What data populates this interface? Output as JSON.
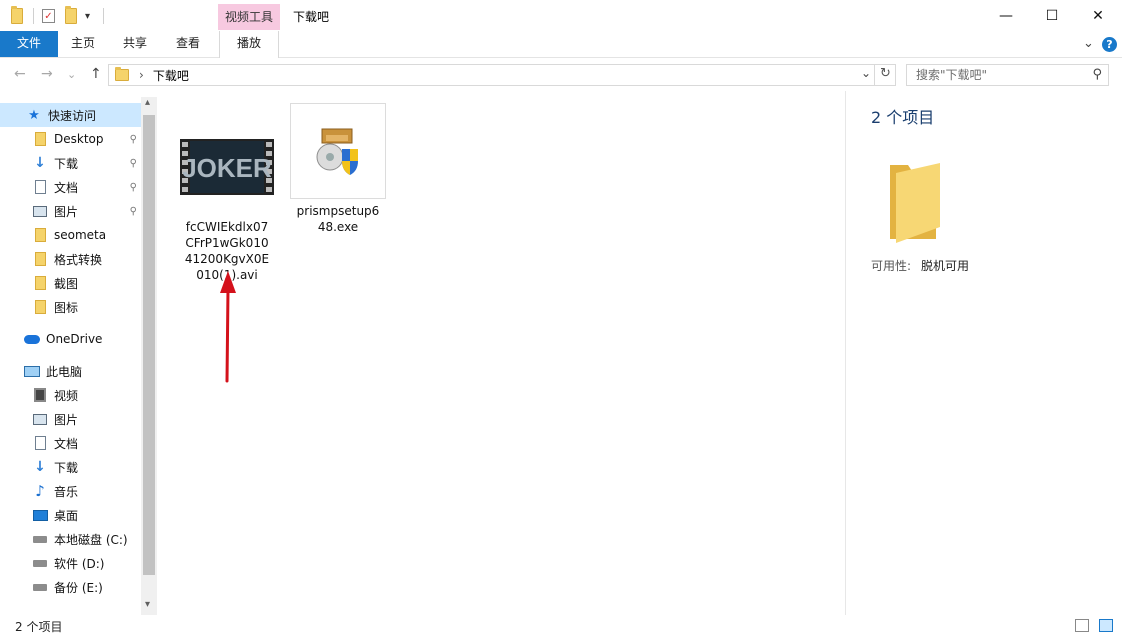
{
  "window": {
    "title": "下载吧",
    "context_tab": "视频工具",
    "minimize_glyph": "—",
    "maximize_glyph": "☐",
    "close_glyph": "✕"
  },
  "ribbon": {
    "tabs": [
      {
        "label": "文件"
      },
      {
        "label": "主页"
      },
      {
        "label": "共享"
      },
      {
        "label": "查看"
      },
      {
        "label": "播放"
      }
    ],
    "collapse_glyph": "⌄",
    "help_glyph": "?"
  },
  "address": {
    "path": "下载吧",
    "back_glyph": "←",
    "forward_glyph": "→",
    "recent_glyph": "⌄",
    "up_glyph": "↑",
    "breadcrumb_sep": "›",
    "dropdown_glyph": "⌄",
    "refresh_glyph": "↻"
  },
  "search": {
    "placeholder": "搜索\"下载吧\"",
    "icon_glyph": "⚲"
  },
  "sidebar": {
    "quick_access": "快速访问",
    "quick_items": [
      {
        "label": "Desktop"
      },
      {
        "label": "下载"
      },
      {
        "label": "文档"
      },
      {
        "label": "图片"
      },
      {
        "label": "seometa"
      },
      {
        "label": "格式转换"
      },
      {
        "label": "截图"
      },
      {
        "label": "图标"
      }
    ],
    "onedrive": "OneDrive",
    "this_pc": "此电脑",
    "pc_items": [
      {
        "label": "视频"
      },
      {
        "label": "图片"
      },
      {
        "label": "文档"
      },
      {
        "label": "下载"
      },
      {
        "label": "音乐"
      },
      {
        "label": "桌面"
      },
      {
        "label": "本地磁盘 (C:)"
      },
      {
        "label": "软件 (D:)"
      },
      {
        "label": "备份 (E:)"
      }
    ],
    "scroll_up_glyph": "▴",
    "scroll_down_glyph": "▾",
    "pin_glyph": "📌"
  },
  "files": [
    {
      "name": "fcCWIEkdlx07CFrP1wGk01041200KgvX0E010(1).avi",
      "thumb_text": "JOKER"
    },
    {
      "name": "prismpsetup648.exe"
    }
  ],
  "details": {
    "count": "2 个项目",
    "availability_label": "可用性:",
    "availability_value": "脱机可用"
  },
  "status": {
    "count": "2 个项目"
  },
  "colors": {
    "accent": "#1979ca",
    "context_tab": "#f7c9e0",
    "selection": "#cce8ff",
    "arrow": "#d4111b"
  }
}
